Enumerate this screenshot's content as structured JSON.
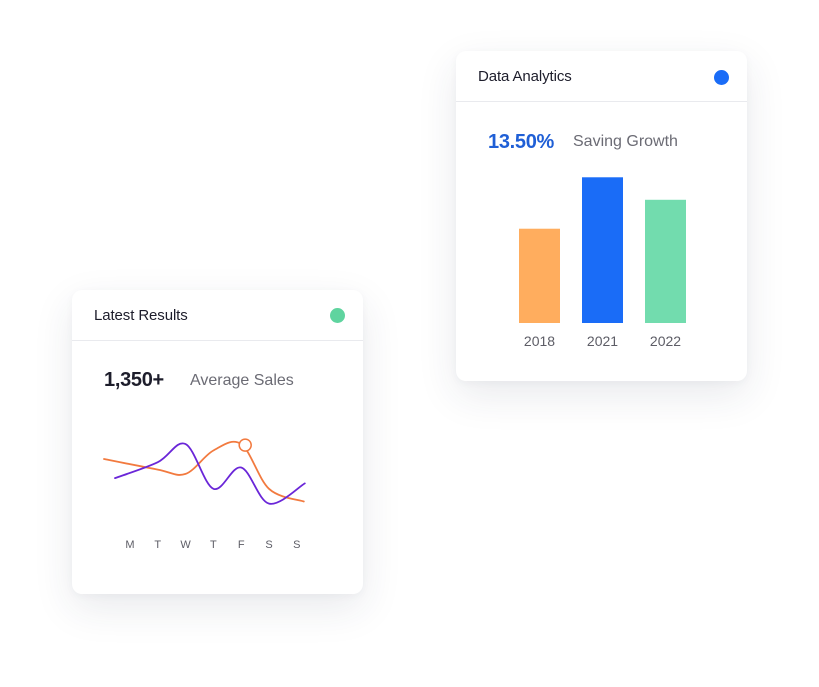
{
  "colors": {
    "blue": "#1a6cf7",
    "orange": "#ffad5e",
    "green": "#72dcae",
    "purple": "#6a26d8",
    "line_orange": "#f27a3f",
    "dot_green": "#5fd49f",
    "value_blue": "#1f5fd6"
  },
  "analytics": {
    "title": "Data Analytics",
    "value": "13.50%",
    "label": "Saving Growth"
  },
  "results": {
    "title": "Latest Results",
    "value": "1,350+",
    "label": "Average Sales"
  },
  "chart_data": [
    {
      "type": "bar",
      "title": "",
      "categories": [
        "2018",
        "2021",
        "2022"
      ],
      "values": [
        88,
        136,
        115
      ],
      "colors": [
        "#ffad5e",
        "#1a6cf7",
        "#72dcae"
      ],
      "ylim": [
        0,
        140
      ],
      "grid": false
    },
    {
      "type": "line",
      "title": "",
      "categories": [
        "M",
        "T",
        "W",
        "T",
        "F",
        "S",
        "S"
      ],
      "series": [
        {
          "values": [
            30,
            45,
            62,
            20,
            40,
            6,
            25
          ],
          "color": "#6a26d8"
        },
        {
          "values": [
            48,
            38,
            34,
            56,
            62,
            20,
            8
          ],
          "color": "#f27a3f",
          "marker_index": 4
        }
      ],
      "ylim": [
        0,
        80
      ],
      "grid": false
    }
  ]
}
